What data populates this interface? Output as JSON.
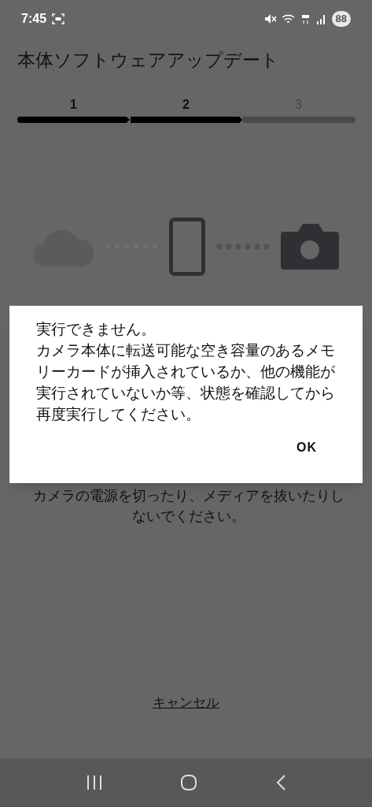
{
  "status_bar": {
    "time": "7:45",
    "battery": "88"
  },
  "title": "本体ソフトウェアアップデート",
  "steps": [
    {
      "label": "1",
      "completed": true
    },
    {
      "label": "2",
      "completed": true
    },
    {
      "label": "3",
      "completed": false
    }
  ],
  "notice": "カメラの電源を切ったり、メディアを抜いたりしないでください。",
  "cancel": "キャンセル",
  "dialog": {
    "heading": "実行できません。",
    "body": "カメラ本体に転送可能な空き容量のあるメモリーカードが挿入されているか、他の機能が実行されていないか等、状態を確認してから再度実行してください。",
    "button": "OK"
  }
}
